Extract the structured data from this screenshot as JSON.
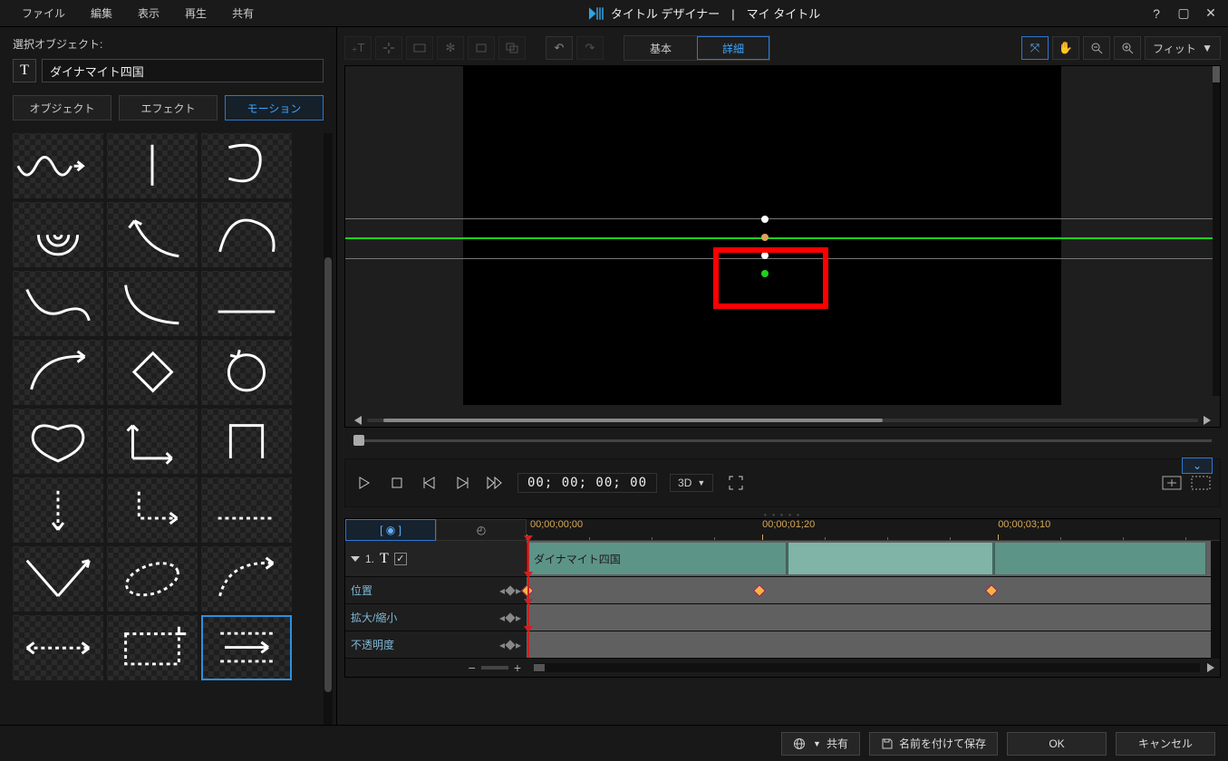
{
  "menubar": [
    "ファイル",
    "編集",
    "表示",
    "再生",
    "共有"
  ],
  "app_title": "タイトル デザイナー",
  "app_subtitle": "マイ タイトル",
  "left": {
    "section_label": "選択オブジェクト:",
    "selected_text": "ダイナマイト四国",
    "tabs": [
      "オブジェクト",
      "エフェクト",
      "モーション"
    ],
    "active_tab": 2
  },
  "toolbar": {
    "mode": {
      "basic": "基本",
      "advanced": "詳細"
    },
    "fit": "フィット"
  },
  "playback": {
    "timecode": "00; 00; 00; 00",
    "dd3d": "3D"
  },
  "timeline": {
    "key_btn": "[ ◉ ]",
    "ruler_tc": [
      "00;00;00;00",
      "00;00;01;20",
      "00;00;03;10"
    ],
    "main_row_num": "1.",
    "clip_label": "ダイナマイト四国",
    "props": [
      "位置",
      "拡大/縮小",
      "不透明度"
    ]
  },
  "footer": {
    "share": "共有",
    "save_as": "名前を付けて保存",
    "ok": "OK",
    "cancel": "キャンセル"
  }
}
